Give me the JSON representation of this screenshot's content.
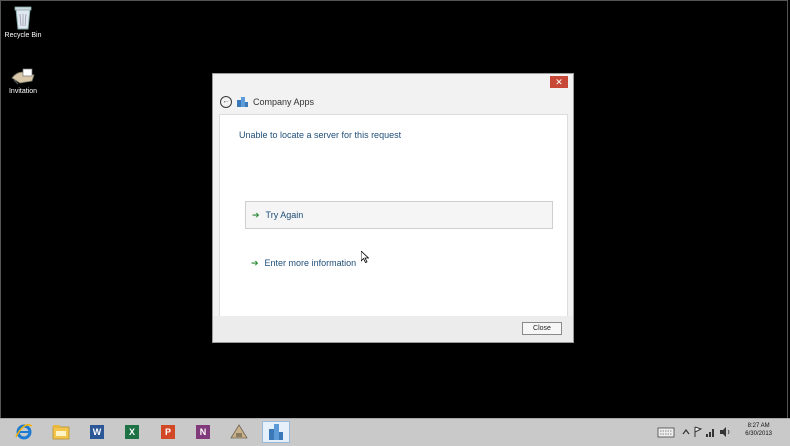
{
  "desktop": {
    "icons": [
      {
        "label": "Recycle Bin",
        "icon": "recycle-bin-icon"
      },
      {
        "label": "Invitation",
        "icon": "invitation-icon"
      }
    ]
  },
  "dialog": {
    "title": "Company Apps",
    "message": "Unable to locate a server for this request",
    "options": [
      {
        "label": "Try Again"
      },
      {
        "label": "Enter more information"
      }
    ],
    "close_button": "Close",
    "close_glyph": "✕"
  },
  "taskbar": {
    "apps": [
      "internet-explorer-icon",
      "file-explorer-icon",
      "word-icon",
      "excel-icon",
      "powerpoint-icon",
      "onenote-icon",
      "remote-app-icon",
      "company-apps-icon"
    ],
    "clock": {
      "time": "8:27 AM",
      "date": "6/30/2013"
    }
  },
  "colors": {
    "accent": "#1f4e79",
    "close": "#c74837",
    "arrow": "#2a8a33"
  }
}
